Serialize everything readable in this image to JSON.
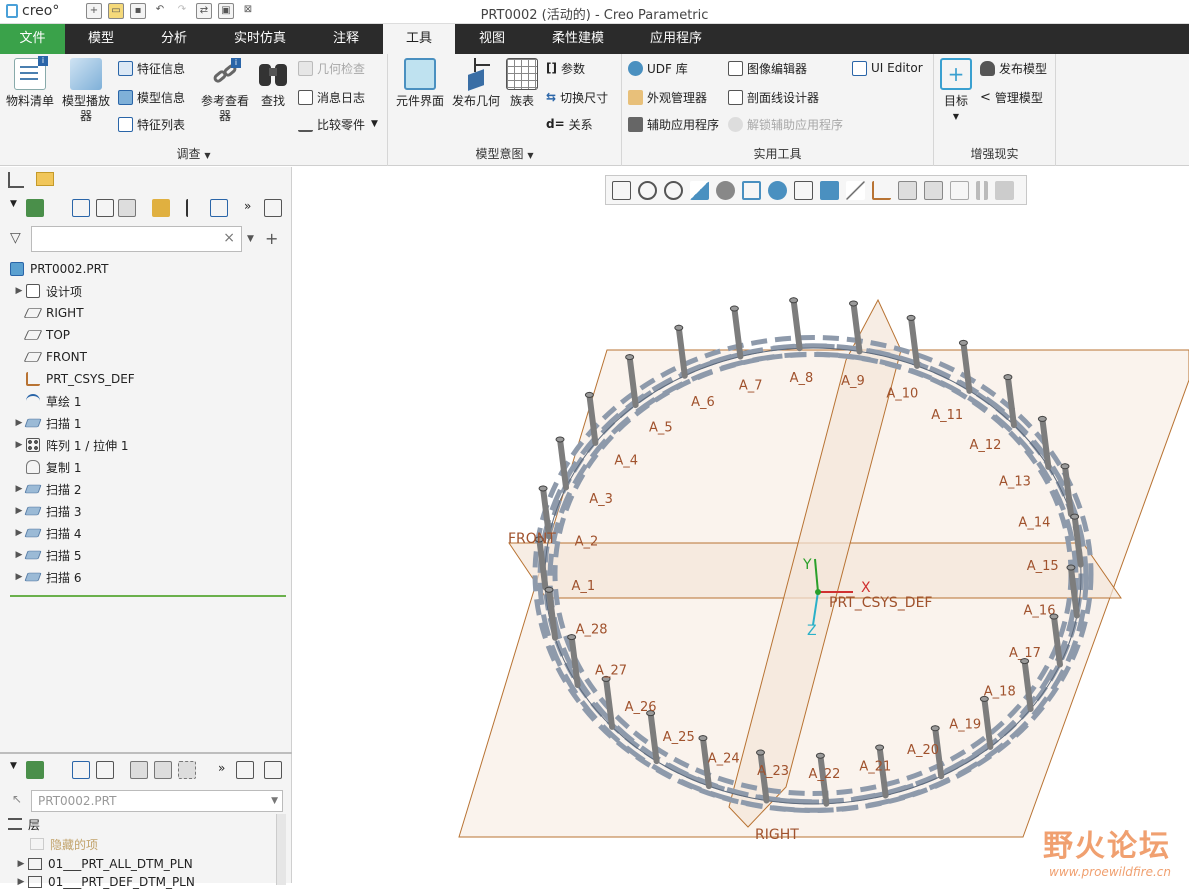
{
  "window": {
    "app_logo": "creo°",
    "title": "PRT0002 (活动的) - Creo Parametric"
  },
  "tabs": [
    {
      "label": "文件"
    },
    {
      "label": "模型"
    },
    {
      "label": "分析"
    },
    {
      "label": "实时仿真"
    },
    {
      "label": "注释"
    },
    {
      "label": "工具"
    },
    {
      "label": "视图"
    },
    {
      "label": "柔性建模"
    },
    {
      "label": "应用程序"
    }
  ],
  "ribbon": {
    "investigate": {
      "label": "调查",
      "bom": "物料清单",
      "model_player_1": "模型播放",
      "model_player_2": "器",
      "feature_info": "特征信息",
      "model_info": "模型信息",
      "feature_list": "特征列表",
      "ref_viewer_1": "参考查看",
      "ref_viewer_2": "器",
      "find": "查找",
      "geom_check": "几何检查",
      "message_log": "消息日志",
      "compare_part": "比较零件"
    },
    "model_intent": {
      "label": "模型意图",
      "component_interface": "元件界面",
      "publish_geometry": "发布几何",
      "family_table": "族表",
      "parameters": "参数",
      "switch_dims": "切换尺寸",
      "relations": "关系"
    },
    "utilities": {
      "label": "实用工具",
      "udf_library": "UDF 库",
      "appearance_manager": "外观管理器",
      "auxiliary_apps": "辅助应用程序",
      "image_editor": "图像编辑器",
      "xsection_designer": "剖面线设计器",
      "unlock_aux_apps": "解锁辅助应用程序",
      "ui_editor": "UI Editor"
    },
    "ar": {
      "label": "增强现实",
      "target": "目标",
      "publish_model": "发布模型",
      "manage_model": "管理模型"
    }
  },
  "model_tree": {
    "filter_placeholder": "",
    "items": [
      {
        "label": "PRT0002.PRT",
        "icon": "part-icon",
        "arrow": ""
      },
      {
        "label": "设计项",
        "icon": "design-items-icon",
        "arrow": "▶"
      },
      {
        "label": "RIGHT",
        "icon": "datum-plane-icon",
        "arrow": ""
      },
      {
        "label": "TOP",
        "icon": "datum-plane-icon",
        "arrow": ""
      },
      {
        "label": "FRONT",
        "icon": "datum-plane-icon",
        "arrow": ""
      },
      {
        "label": "PRT_CSYS_DEF",
        "icon": "csys-icon",
        "arrow": ""
      },
      {
        "label": "草绘 1",
        "icon": "sketch-icon",
        "arrow": ""
      },
      {
        "label": "扫描 1",
        "icon": "sweep-icon",
        "arrow": "▶"
      },
      {
        "label": "阵列 1 / 拉伸 1",
        "icon": "pattern-icon",
        "arrow": "▶"
      },
      {
        "label": "复制 1",
        "icon": "copy-icon",
        "arrow": ""
      },
      {
        "label": "扫描 2",
        "icon": "sweep-icon",
        "arrow": "▶"
      },
      {
        "label": "扫描 3",
        "icon": "sweep-icon",
        "arrow": "▶"
      },
      {
        "label": "扫描 4",
        "icon": "sweep-icon",
        "arrow": "▶"
      },
      {
        "label": "扫描 5",
        "icon": "sweep-icon",
        "arrow": "▶"
      },
      {
        "label": "扫描 6",
        "icon": "sweep-icon",
        "arrow": "▶"
      }
    ]
  },
  "layer_tree": {
    "model": "PRT0002.PRT",
    "header": "层",
    "hidden_items": "隐藏的项",
    "items": [
      "01___PRT_ALL_DTM_PLN",
      "01___PRT_DEF_DTM_PLN"
    ]
  },
  "scene": {
    "datum_labels": {
      "front": "FRONT",
      "right": "RIGHT",
      "csys": "PRT_CSYS_DEF",
      "x": "X",
      "y": "Y",
      "z": "Z"
    },
    "point_labels": [
      "A_1",
      "A_2",
      "A_3",
      "A_4",
      "A_5",
      "A_6",
      "A_7",
      "A_8",
      "A_9",
      "A_10",
      "A_11",
      "A_12",
      "A_13",
      "A_14",
      "A_15",
      "A_16",
      "A_17",
      "A_18",
      "A_19",
      "A_20",
      "A_21",
      "A_22",
      "A_23",
      "A_24",
      "A_25",
      "A_26",
      "A_27",
      "A_28"
    ],
    "colors": {
      "plane_edge": "#b87333",
      "plane_fill": "#f3e5d8",
      "wire": "#8e9aab",
      "peg": "#7d7d7d",
      "label": "#a0522d"
    }
  },
  "watermark": {
    "title": "野火论坛",
    "url": "www.proewildfire.cn"
  }
}
